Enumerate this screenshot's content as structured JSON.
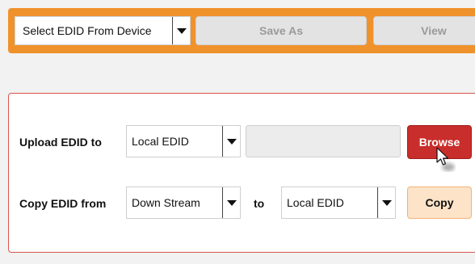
{
  "toolbar": {
    "select_label": "Select EDID From Device",
    "save_as_label": "Save As",
    "view_label": "View"
  },
  "upload": {
    "label": "Upload EDID to",
    "target_value": "Local EDID",
    "browse_label": "Browse"
  },
  "copy": {
    "label": "Copy EDID from",
    "source_value": "Down Stream",
    "to_label": "to",
    "dest_value": "Local EDID",
    "copy_label": "Copy"
  },
  "colors": {
    "toolbar_orange": "#f0922c",
    "browse_red": "#c82e2b",
    "copy_peach": "#fde3c8",
    "panel_border": "#d9534f"
  }
}
